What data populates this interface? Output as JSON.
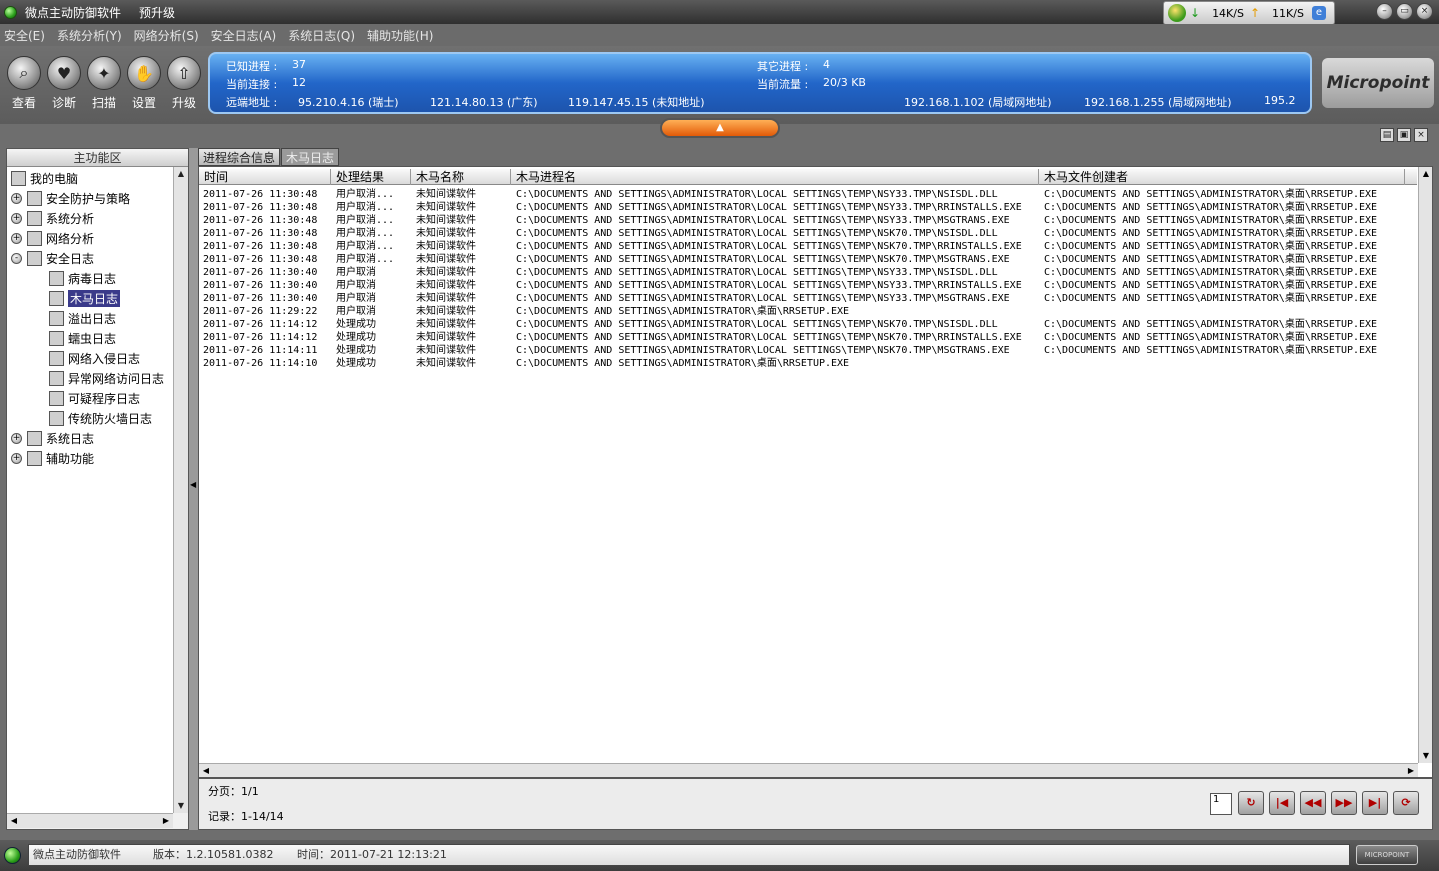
{
  "app": {
    "title": "微点主动防御软件",
    "upgrade_label": "预升级"
  },
  "network": {
    "down_speed": "14K/S",
    "up_speed": "11K/S"
  },
  "window_buttons": [
    "minimize-icon",
    "restore-icon",
    "close-icon"
  ],
  "menu": [
    "安全(E)",
    "系统分析(Y)",
    "网络分析(S)",
    "安全日志(A)",
    "系统日志(Q)",
    "辅助功能(H)"
  ],
  "toolbar": [
    {
      "label": "查看",
      "icon": "magnifier-icon"
    },
    {
      "label": "诊断",
      "icon": "heart-icon"
    },
    {
      "label": "扫描",
      "icon": "scan-icon"
    },
    {
      "label": "设置",
      "icon": "hand-icon"
    },
    {
      "label": "升级",
      "icon": "upgrade-icon"
    }
  ],
  "info": {
    "known_label": "已知进程 :",
    "known_value": "37",
    "other_label": "其它进程 :",
    "other_value": "4",
    "conn_label": "当前连接 :",
    "conn_value": "12",
    "traffic_label": "当前流量 :",
    "traffic_value": "20/3 KB",
    "remote_label": "远端地址 :",
    "remote_addrs": [
      "95.210.4.16 (瑞士)",
      "121.14.80.13 (广东)",
      "119.147.45.15 (未知地址)",
      "192.168.1.102 (局域网地址)",
      "192.168.1.255 (局域网地址)",
      "195.2"
    ]
  },
  "brand": "Micropoint",
  "left_panel": {
    "title": "主功能区",
    "tree": [
      {
        "label": "我的电脑",
        "level": 0,
        "expander": "",
        "icon": "computer-icon"
      },
      {
        "label": "安全防护与策略",
        "level": 1,
        "expander": "+",
        "icon": "shield-icon"
      },
      {
        "label": "系统分析",
        "level": 1,
        "expander": "+",
        "icon": "system-icon"
      },
      {
        "label": "网络分析",
        "level": 1,
        "expander": "+",
        "icon": "network-icon"
      },
      {
        "label": "安全日志",
        "level": 1,
        "expander": "-",
        "icon": "log-icon"
      },
      {
        "label": "病毒日志",
        "level": 2,
        "expander": "",
        "icon": "virus-icon"
      },
      {
        "label": "木马日志",
        "level": 2,
        "expander": "",
        "icon": "trojan-icon",
        "selected": true
      },
      {
        "label": "溢出日志",
        "level": 2,
        "expander": "",
        "icon": "overflow-icon"
      },
      {
        "label": "蠕虫日志",
        "level": 2,
        "expander": "",
        "icon": "worm-icon"
      },
      {
        "label": "网络入侵日志",
        "level": 2,
        "expander": "",
        "icon": "sword-icon"
      },
      {
        "label": "异常网络访问日志",
        "level": 2,
        "expander": "",
        "icon": "doc-icon"
      },
      {
        "label": "可疑程序日志",
        "level": 2,
        "expander": "",
        "icon": "doc-icon"
      },
      {
        "label": "传统防火墙日志",
        "level": 2,
        "expander": "",
        "icon": "doc-icon"
      },
      {
        "label": "系统日志",
        "level": 1,
        "expander": "+",
        "icon": "syslog-icon"
      },
      {
        "label": "辅助功能",
        "level": 1,
        "expander": "+",
        "icon": "tools-icon"
      }
    ]
  },
  "tabs": [
    {
      "label": "进程综合信息",
      "active": false
    },
    {
      "label": "木马日志",
      "active": true
    }
  ],
  "table": {
    "columns": [
      "时间",
      "处理结果",
      "木马名称",
      "木马进程名",
      "木马文件创建者"
    ],
    "rows": [
      [
        "2011-07-26 11:30:48",
        "用户取消...",
        "未知间谍软件",
        "C:\\DOCUMENTS AND SETTINGS\\ADMINISTRATOR\\LOCAL SETTINGS\\TEMP\\NSY33.TMP\\NSISDL.DLL",
        "C:\\DOCUMENTS AND SETTINGS\\ADMINISTRATOR\\桌面\\RRSETUP.EXE"
      ],
      [
        "2011-07-26 11:30:48",
        "用户取消...",
        "未知间谍软件",
        "C:\\DOCUMENTS AND SETTINGS\\ADMINISTRATOR\\LOCAL SETTINGS\\TEMP\\NSY33.TMP\\RRINSTALLS.EXE",
        "C:\\DOCUMENTS AND SETTINGS\\ADMINISTRATOR\\桌面\\RRSETUP.EXE"
      ],
      [
        "2011-07-26 11:30:48",
        "用户取消...",
        "未知间谍软件",
        "C:\\DOCUMENTS AND SETTINGS\\ADMINISTRATOR\\LOCAL SETTINGS\\TEMP\\NSY33.TMP\\MSGTRANS.EXE",
        "C:\\DOCUMENTS AND SETTINGS\\ADMINISTRATOR\\桌面\\RRSETUP.EXE"
      ],
      [
        "2011-07-26 11:30:48",
        "用户取消...",
        "未知间谍软件",
        "C:\\DOCUMENTS AND SETTINGS\\ADMINISTRATOR\\LOCAL SETTINGS\\TEMP\\NSK70.TMP\\NSISDL.DLL",
        "C:\\DOCUMENTS AND SETTINGS\\ADMINISTRATOR\\桌面\\RRSETUP.EXE"
      ],
      [
        "2011-07-26 11:30:48",
        "用户取消...",
        "未知间谍软件",
        "C:\\DOCUMENTS AND SETTINGS\\ADMINISTRATOR\\LOCAL SETTINGS\\TEMP\\NSK70.TMP\\RRINSTALLS.EXE",
        "C:\\DOCUMENTS AND SETTINGS\\ADMINISTRATOR\\桌面\\RRSETUP.EXE"
      ],
      [
        "2011-07-26 11:30:48",
        "用户取消...",
        "未知间谍软件",
        "C:\\DOCUMENTS AND SETTINGS\\ADMINISTRATOR\\LOCAL SETTINGS\\TEMP\\NSK70.TMP\\MSGTRANS.EXE",
        "C:\\DOCUMENTS AND SETTINGS\\ADMINISTRATOR\\桌面\\RRSETUP.EXE"
      ],
      [
        "2011-07-26 11:30:40",
        "用户取消",
        "未知间谍软件",
        "C:\\DOCUMENTS AND SETTINGS\\ADMINISTRATOR\\LOCAL SETTINGS\\TEMP\\NSY33.TMP\\NSISDL.DLL",
        "C:\\DOCUMENTS AND SETTINGS\\ADMINISTRATOR\\桌面\\RRSETUP.EXE"
      ],
      [
        "2011-07-26 11:30:40",
        "用户取消",
        "未知间谍软件",
        "C:\\DOCUMENTS AND SETTINGS\\ADMINISTRATOR\\LOCAL SETTINGS\\TEMP\\NSY33.TMP\\RRINSTALLS.EXE",
        "C:\\DOCUMENTS AND SETTINGS\\ADMINISTRATOR\\桌面\\RRSETUP.EXE"
      ],
      [
        "2011-07-26 11:30:40",
        "用户取消",
        "未知间谍软件",
        "C:\\DOCUMENTS AND SETTINGS\\ADMINISTRATOR\\LOCAL SETTINGS\\TEMP\\NSY33.TMP\\MSGTRANS.EXE",
        "C:\\DOCUMENTS AND SETTINGS\\ADMINISTRATOR\\桌面\\RRSETUP.EXE"
      ],
      [
        "2011-07-26 11:29:22",
        "用户取消",
        "未知间谍软件",
        "C:\\DOCUMENTS AND SETTINGS\\ADMINISTRATOR\\桌面\\RRSETUP.EXE",
        ""
      ],
      [
        "2011-07-26 11:14:12",
        "处理成功",
        "未知间谍软件",
        "C:\\DOCUMENTS AND SETTINGS\\ADMINISTRATOR\\LOCAL SETTINGS\\TEMP\\NSK70.TMP\\NSISDL.DLL",
        "C:\\DOCUMENTS AND SETTINGS\\ADMINISTRATOR\\桌面\\RRSETUP.EXE"
      ],
      [
        "2011-07-26 11:14:12",
        "处理成功",
        "未知间谍软件",
        "C:\\DOCUMENTS AND SETTINGS\\ADMINISTRATOR\\LOCAL SETTINGS\\TEMP\\NSK70.TMP\\RRINSTALLS.EXE",
        "C:\\DOCUMENTS AND SETTINGS\\ADMINISTRATOR\\桌面\\RRSETUP.EXE"
      ],
      [
        "2011-07-26 11:14:11",
        "处理成功",
        "未知间谍软件",
        "C:\\DOCUMENTS AND SETTINGS\\ADMINISTRATOR\\LOCAL SETTINGS\\TEMP\\NSK70.TMP\\MSGTRANS.EXE",
        "C:\\DOCUMENTS AND SETTINGS\\ADMINISTRATOR\\桌面\\RRSETUP.EXE"
      ],
      [
        "2011-07-26 11:14:10",
        "处理成功",
        "未知间谍软件",
        "C:\\DOCUMENTS AND SETTINGS\\ADMINISTRATOR\\桌面\\RRSETUP.EXE",
        ""
      ]
    ]
  },
  "pager": {
    "page_text": "分页：1/1",
    "record_text": "记录：1-14/14",
    "page_input": "1",
    "controls": [
      {
        "name": "refresh-button",
        "icon": "refresh-icon",
        "glyph": "↻"
      },
      {
        "name": "first-page-button",
        "icon": "first-page-icon",
        "glyph": "|◀"
      },
      {
        "name": "prev-page-button",
        "icon": "prev-page-icon",
        "glyph": "◀◀"
      },
      {
        "name": "next-page-button",
        "icon": "next-page-icon",
        "glyph": "▶▶"
      },
      {
        "name": "last-page-button",
        "icon": "last-page-icon",
        "glyph": "▶|"
      },
      {
        "name": "reload-button",
        "icon": "reload-icon",
        "glyph": "⟳"
      }
    ]
  },
  "status": {
    "app_name": "微点主动防御软件",
    "version": "版本：1.2.10581.0382",
    "time": "时间：2011-07-21  12:13:21",
    "brand_small": "MICROPOINT"
  }
}
